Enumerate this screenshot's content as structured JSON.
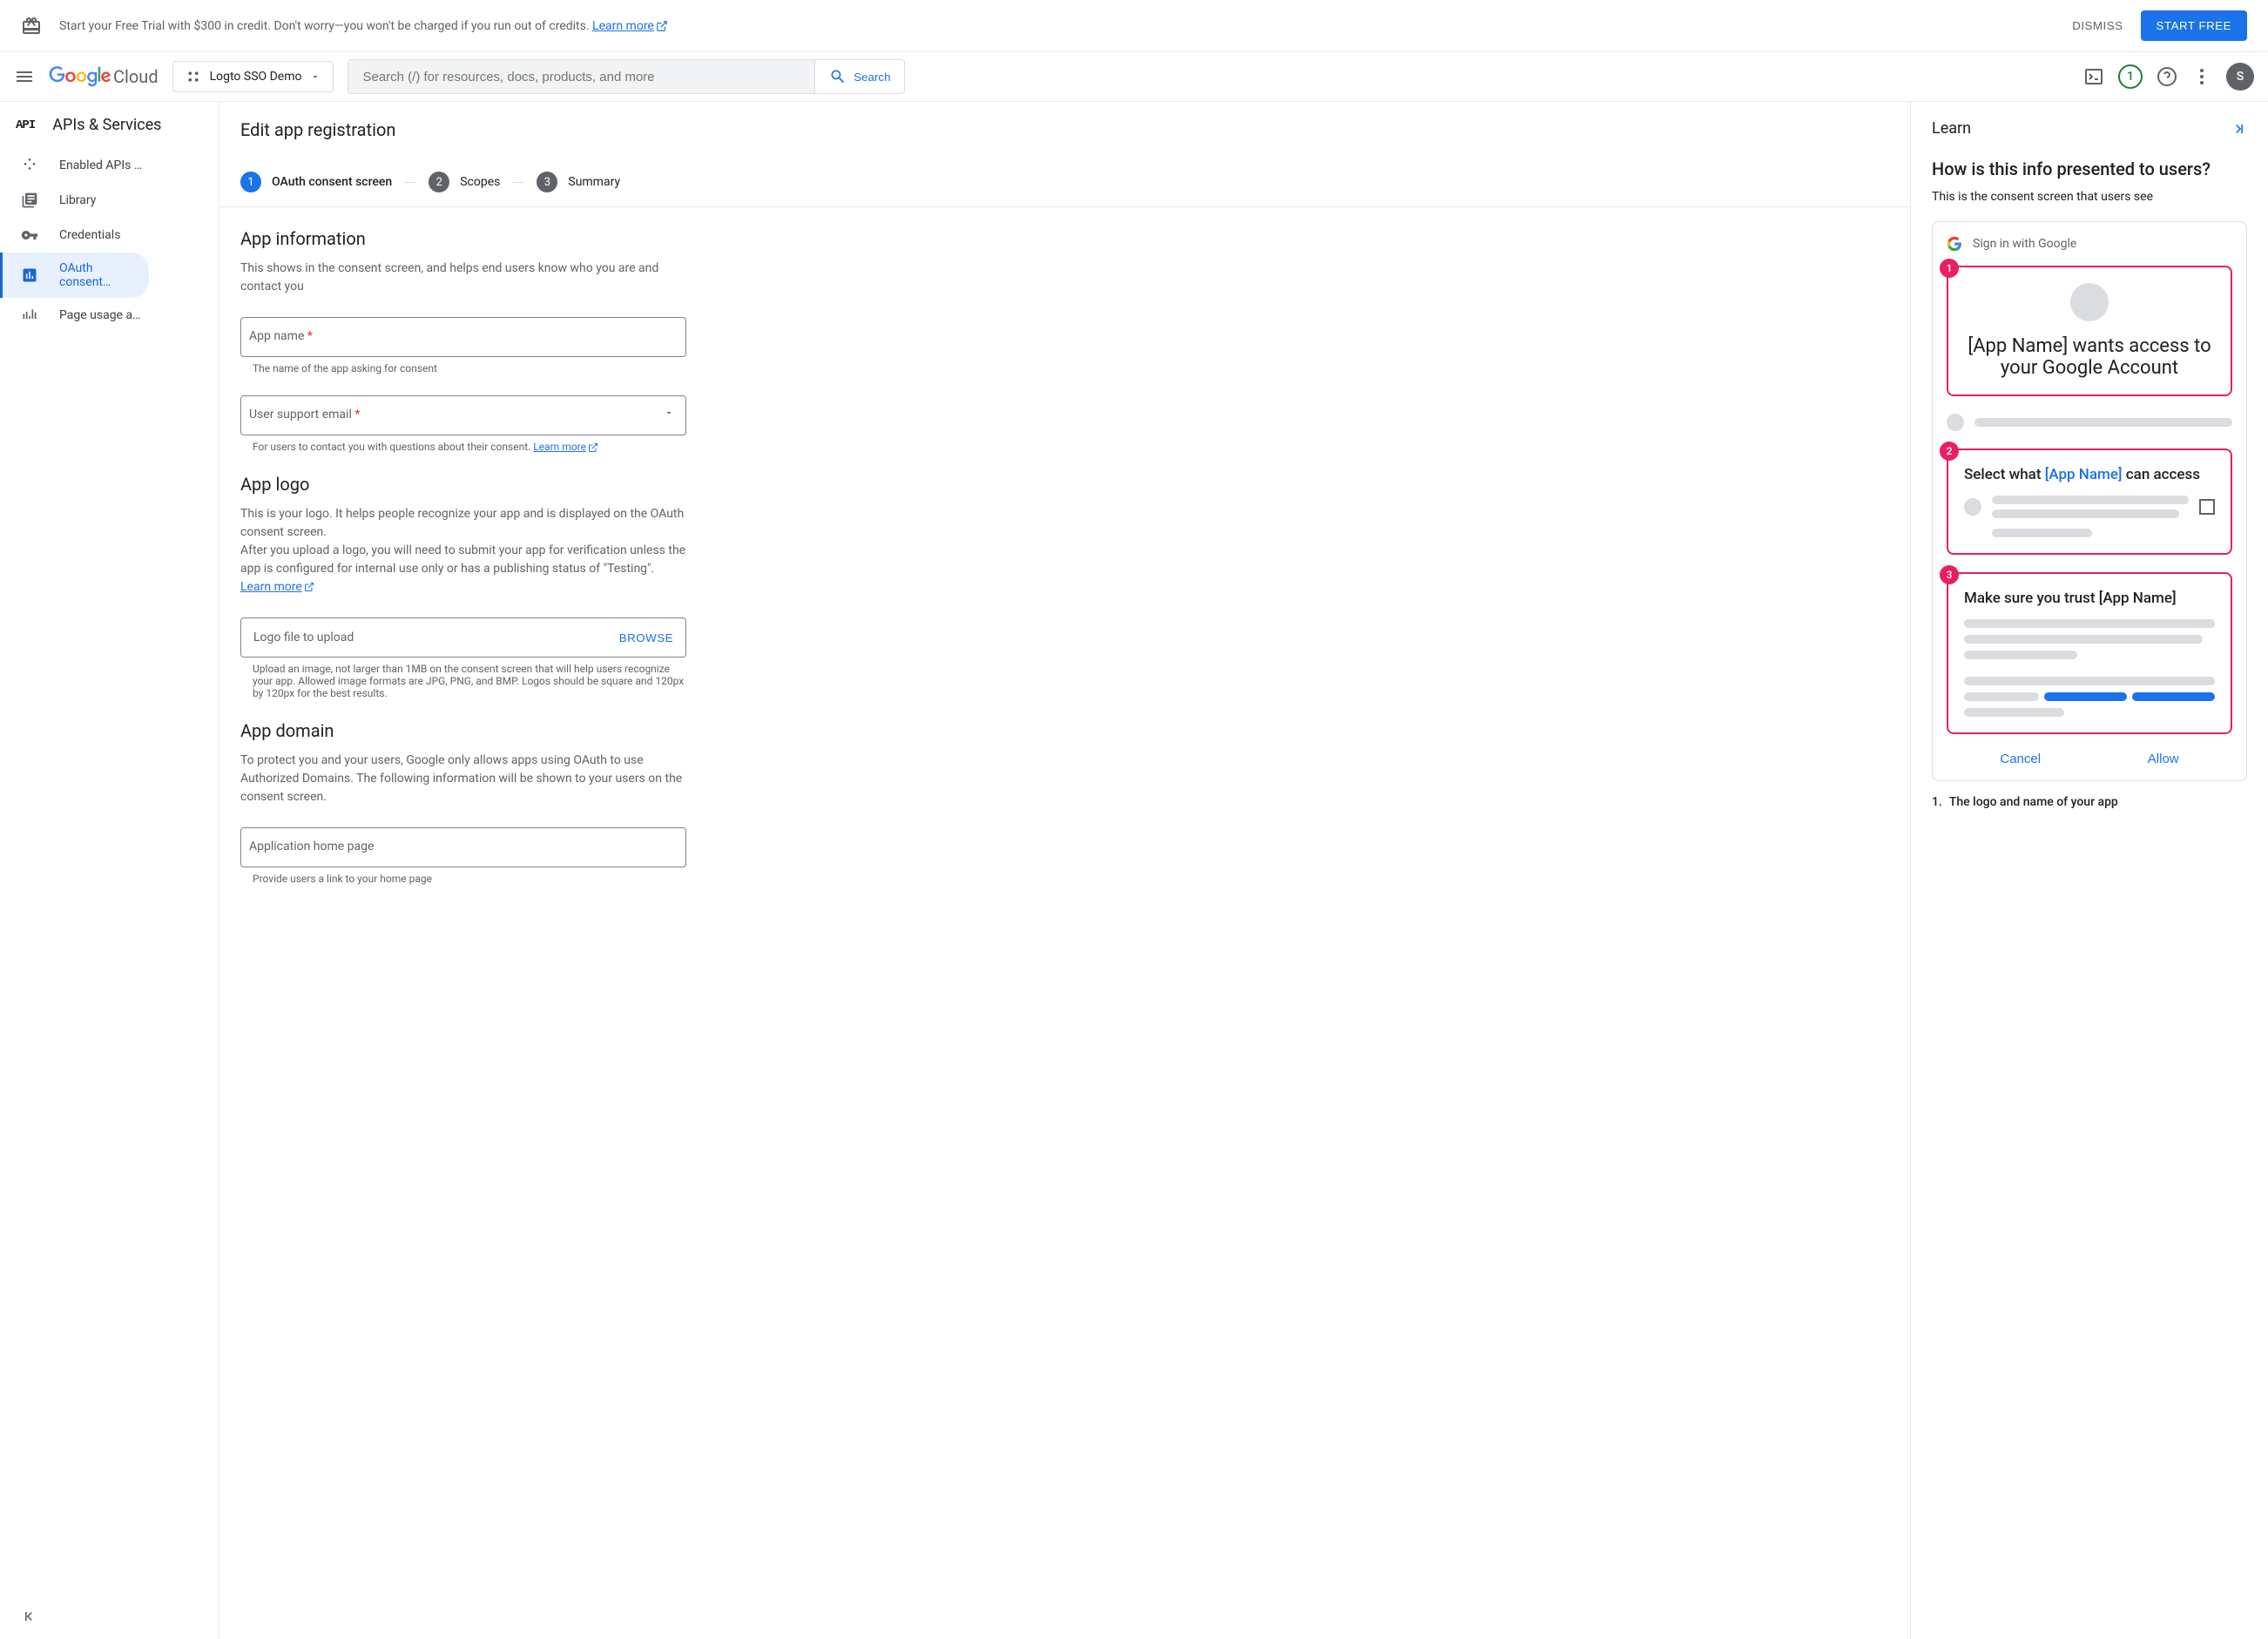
{
  "banner": {
    "text": "Start your Free Trial with $300 in credit. Don't worry—you won't be charged if you run out of credits. ",
    "learn_more": "Learn more",
    "dismiss": "DISMISS",
    "start_free": "START FREE"
  },
  "header": {
    "logo_cloud": "Cloud",
    "project_name": "Logto SSO Demo",
    "search_placeholder": "Search (/) for resources, docs, products, and more",
    "search_button": "Search",
    "trial_badge": "1",
    "avatar_initial": "S"
  },
  "sidebar": {
    "title": "APIs & Services",
    "items": [
      {
        "label": "Enabled APIs …"
      },
      {
        "label": "Library"
      },
      {
        "label": "Credentials"
      },
      {
        "label": "OAuth consent…"
      },
      {
        "label": "Page usage a…"
      }
    ]
  },
  "content": {
    "title": "Edit app registration",
    "stepper": {
      "step1": "OAuth consent screen",
      "step2": "Scopes",
      "step3": "Summary"
    },
    "app_info": {
      "title": "App information",
      "desc": "This shows in the consent screen, and helps end users know who you are and contact you",
      "app_name_label": "App name ",
      "app_name_help": "The name of the app asking for consent",
      "support_email_label": "User support email ",
      "support_email_help": "For users to contact you with questions about their consent. ",
      "support_email_learn": "Learn more"
    },
    "app_logo": {
      "title": "App logo",
      "desc1": "This is your logo. It helps people recognize your app and is displayed on the OAuth consent screen.",
      "desc2": "After you upload a logo, you will need to submit your app for verification unless the app is configured for internal use only or has a publishing status of \"Testing\". ",
      "desc2_learn": "Learn more",
      "upload_label": "Logo file to upload",
      "browse": "BROWSE",
      "upload_help": "Upload an image, not larger than 1MB on the consent screen that will help users recognize your app. Allowed image formats are JPG, PNG, and BMP. Logos should be square and 120px by 120px for the best results."
    },
    "app_domain": {
      "title": "App domain",
      "desc": "To protect you and your users, Google only allows apps using OAuth to use Authorized Domains. The following information will be shown to your users on the consent screen.",
      "home_page_label": "Application home page",
      "home_page_help": "Provide users a link to your home page"
    }
  },
  "learn": {
    "title": "Learn",
    "heading": "How is this info presented to users?",
    "desc": "This is the consent screen that users see",
    "signin_text": "Sign in with Google",
    "preview1_title": "[App Name] wants access to your Google Account",
    "preview2_prefix": "Select what ",
    "preview2_app": "[App Name]",
    "preview2_suffix": " can access",
    "preview3_title": "Make sure you trust [App Name]",
    "cancel": "Cancel",
    "allow": "Allow",
    "list_1_num": "1.",
    "list_1": "The logo and name of your app"
  }
}
